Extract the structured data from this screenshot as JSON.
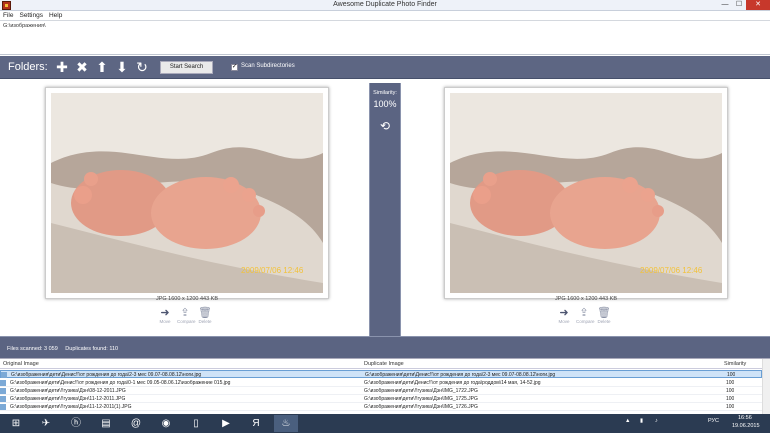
{
  "window": {
    "title": "Awesome Duplicate Photo Finder",
    "minimize": "—",
    "maximize": "☐",
    "close": "✕"
  },
  "menu": [
    "File",
    "Settings",
    "Help"
  ],
  "path_list": [
    "G:\\изображения\\"
  ],
  "toolbar": {
    "folders_label": "Folders:",
    "start_search": "Start Search",
    "scan_subdirectories": "Scan Subdirectories",
    "scan_checked": "✓"
  },
  "similarity": {
    "label": "Similarity:",
    "value": "100%"
  },
  "left_image": {
    "info": "JPG  1600 x 1200  443 KB",
    "date_stamp": "2009/07/06 12:46",
    "actions": [
      "Move",
      "Compare",
      "Delete"
    ]
  },
  "right_image": {
    "info": "JPG  1600 x 1200  443 KB",
    "date_stamp": "2009/07/06 12:46",
    "actions": [
      "Move",
      "Compare",
      "Delete"
    ]
  },
  "status": {
    "files_scanned": "Files scanned: 3 059",
    "duplicates_found": "Duplicates found: 110"
  },
  "table": {
    "headers": {
      "original": "Original Image",
      "duplicate": "Duplicate Image",
      "similarity": "Similarity"
    },
    "rows": [
      {
        "original": "G:\\изображения\\дети\\Денис!!\\от рождения до года\\2-3 мес 09.07-08.08.12\\ноги.jpg",
        "duplicate": "G:\\изображения\\дети\\Денис!!\\от рождения до года\\2-3 мес 09.07-08.08.12\\ноги.jpg",
        "similarity": "100"
      },
      {
        "original": "G:\\изображения\\дети\\Денис!!\\от рождения до года\\0-1 мес 09.05-08.06.12\\изображение 015.jpg",
        "duplicate": "G:\\изображения\\дети\\Денис!!\\от рождения до года\\роддом\\14 мая, 14-52.jpg",
        "similarity": "100"
      },
      {
        "original": "G:\\изображения\\дети\\!!гузика\\Дэн\\08-12-2011.JPG",
        "duplicate": "G:\\изображения\\дети\\!!гузика\\Дэн\\IMG_1722.JPG",
        "similarity": "100"
      },
      {
        "original": "G:\\изображения\\дети\\!!гузика\\Дэн\\11-12-2011.JPG",
        "duplicate": "G:\\изображения\\дети\\!!гузика\\Дэн\\IMG_1725.JPG",
        "similarity": "100"
      },
      {
        "original": "G:\\изображения\\дети\\!!гузика\\Дэн\\11-12-2011(1).JPG",
        "duplicate": "G:\\изображения\\дети\\!!гузика\\Дэн\\IMG_1726.JPG",
        "similarity": "100"
      }
    ]
  },
  "taskbar": {
    "apps": [
      "windows-start",
      "hp",
      "file-explorer",
      "email",
      "chrome",
      "document",
      "media-player",
      "yandex",
      "awesome-duplicate-photo-finder"
    ],
    "language": "РУС",
    "time": "16:56",
    "date": "19.06.2015"
  }
}
